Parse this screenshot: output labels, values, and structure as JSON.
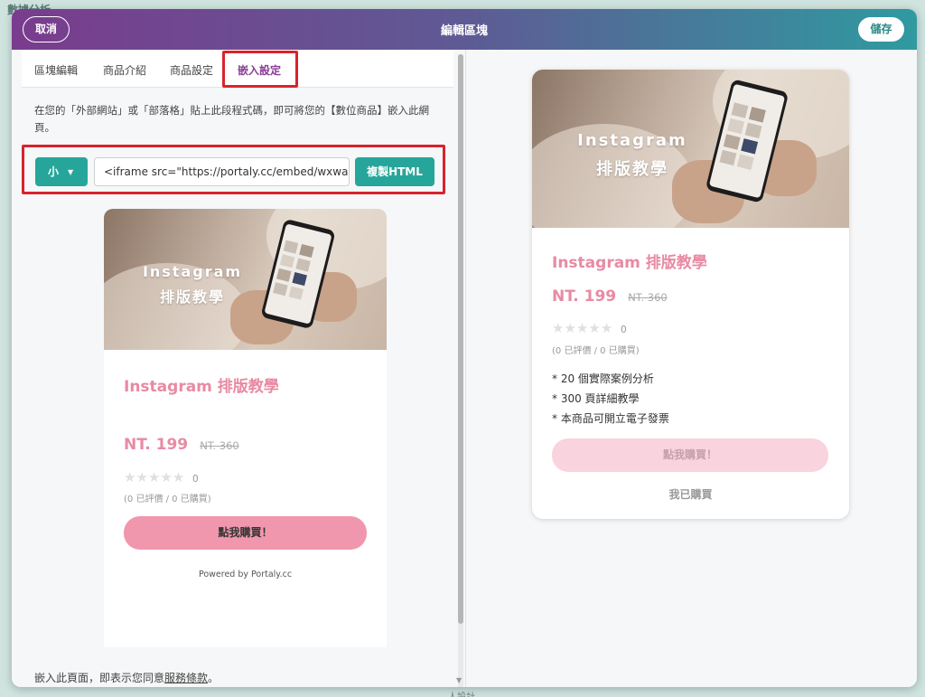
{
  "background": {
    "top_label": "數據分析",
    "bottom_label": "人設計"
  },
  "header": {
    "title": "編輯區塊",
    "cancel_label": "取消",
    "save_label": "儲存"
  },
  "tabs": [
    {
      "label": "區塊編輯",
      "active": false
    },
    {
      "label": "商品介紹",
      "active": false
    },
    {
      "label": "商品設定",
      "active": false
    },
    {
      "label": "嵌入設定",
      "active": true
    }
  ],
  "embed": {
    "description": "在您的「外部網站」或「部落格」貼上此段程式碼，即可將您的【數位商品】嵌入此網頁。",
    "size_label": "小",
    "code_value": "<iframe src=\"https://portaly.cc/embed/wxwa",
    "copy_label": "複製HTML"
  },
  "product": {
    "hero_line1": "Instagram",
    "hero_line2": "排版教學",
    "title": "Instagram 排版教學",
    "price": "NT. 199",
    "original_price": "NT. 360",
    "rating_value": "0",
    "rating_max": 5,
    "rating_summary": "(0 已評價 / 0 已購買)",
    "features": [
      "* 20 個實際案例分析",
      "* 300 頁詳細教學",
      "* 本商品可開立電子發票"
    ],
    "buy_label": "點我購買！",
    "bought_label": "我已購買",
    "powered_by": "Powered by Portaly.cc"
  },
  "terms": {
    "prefix": "嵌入此頁面，即表示您同意",
    "link": "服務條款",
    "suffix": "。"
  },
  "colors": {
    "accent": "#26a69a",
    "pink": "#e88aa3",
    "highlight_box": "#d9232d",
    "active_tab": "#8a3c96"
  }
}
